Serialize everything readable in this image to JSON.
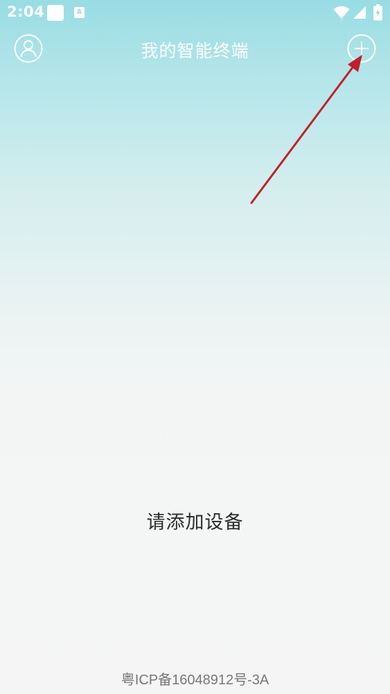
{
  "status_bar": {
    "time": "2:04",
    "notification_letter": "A",
    "icons": [
      "app-notification-icon",
      "a-notification-icon",
      "wifi-icon",
      "cellular-signal-icon",
      "battery-charging-icon"
    ]
  },
  "header": {
    "title": "我的智能终端",
    "profile_icon": "user-profile-icon",
    "add_icon": "plus-icon"
  },
  "main": {
    "empty_message": "请添加设备"
  },
  "footer": {
    "icp": "粤ICP备16048912号-3A"
  },
  "colors": {
    "header_gradient_top": "#98dce4",
    "background": "#f5f5f5",
    "annotation_arrow": "#c0202a",
    "text_primary": "#2b2b2b",
    "text_secondary": "#777777"
  }
}
